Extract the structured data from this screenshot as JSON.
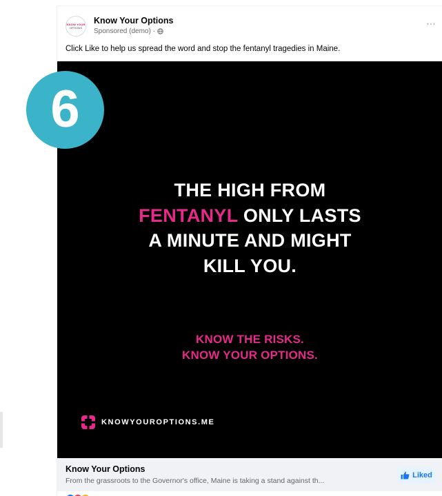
{
  "post": {
    "page_name": "Know Your Options",
    "sponsored_label": "Sponsored (demo) ·",
    "more_label": "···",
    "caption": "Click Like to help us spread the word and stop the fentanyl tragedies in Maine.",
    "avatar": {
      "line1": "KNOW YOUR",
      "line2": "OPTIONS"
    }
  },
  "ad": {
    "headline_line1": "THE HIGH FROM",
    "headline_pink": "FENTANYL",
    "headline_line2_rest": " ONLY LASTS",
    "headline_line3": "A MINUTE AND MIGHT",
    "headline_line4": "KILL YOU.",
    "tagline_line1": "KNOW THE RISKS.",
    "tagline_line2": "KNOW YOUR OPTIONS.",
    "brand_url": "KNOWYOUROPTIONS.ME",
    "colors": {
      "background": "#000000",
      "accent_pink": "#e62a8a",
      "text": "#ffffff"
    }
  },
  "link_preview": {
    "title": "Know Your Options",
    "description": "From the grassroots to the Governor's office, Maine is taking a stand against th...",
    "liked_label": "Liked"
  },
  "badge": {
    "number": "6",
    "color": "#3bb3c8"
  },
  "reactions": {
    "icons": [
      "like-reaction-icon",
      "love-reaction-icon",
      "care-reaction-icon"
    ]
  }
}
